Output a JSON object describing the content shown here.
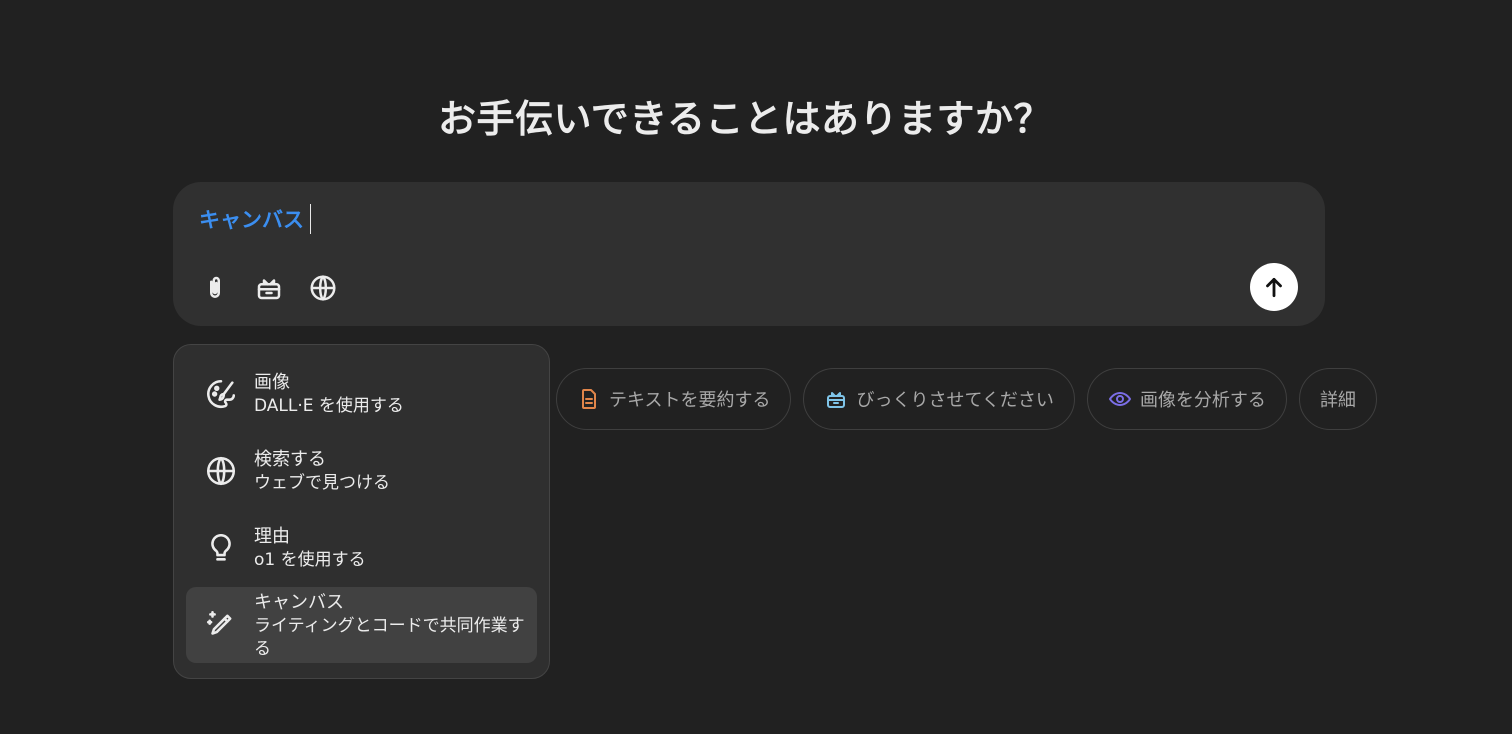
{
  "heading": "お手伝いできることはありますか？",
  "composer": {
    "mention": "キャンバス",
    "tools": [
      {
        "icon": "paperclip-icon",
        "name": "attach-button"
      },
      {
        "icon": "toolbox-icon",
        "name": "tools-button"
      },
      {
        "icon": "globe-icon",
        "name": "search-web-button"
      }
    ],
    "send_icon": "arrow-up-icon"
  },
  "menu": {
    "items": [
      {
        "title": "画像",
        "subtitle": "DALL·E を使用する",
        "icon": "image-brush-icon",
        "active": false
      },
      {
        "title": "検索する",
        "subtitle": "ウェブで見つける",
        "icon": "globe-icon",
        "active": false
      },
      {
        "title": "理由",
        "subtitle": "o1 を使用する",
        "icon": "lightbulb-icon",
        "active": false
      },
      {
        "title": "キャンバス",
        "subtitle": "ライティングとコードで共同作業する",
        "icon": "pencil-sparkle-icon",
        "active": true
      }
    ]
  },
  "chips": [
    {
      "label": "テキストを要約する",
      "icon": "document-icon",
      "color": "#e2864a"
    },
    {
      "label": "びっくりさせてください",
      "icon": "gift-icon",
      "color": "#7fc4e8"
    },
    {
      "label": "画像を分析する",
      "icon": "eye-icon",
      "color": "#7b6ee6"
    },
    {
      "label": "詳細",
      "icon": "",
      "color": ""
    }
  ]
}
